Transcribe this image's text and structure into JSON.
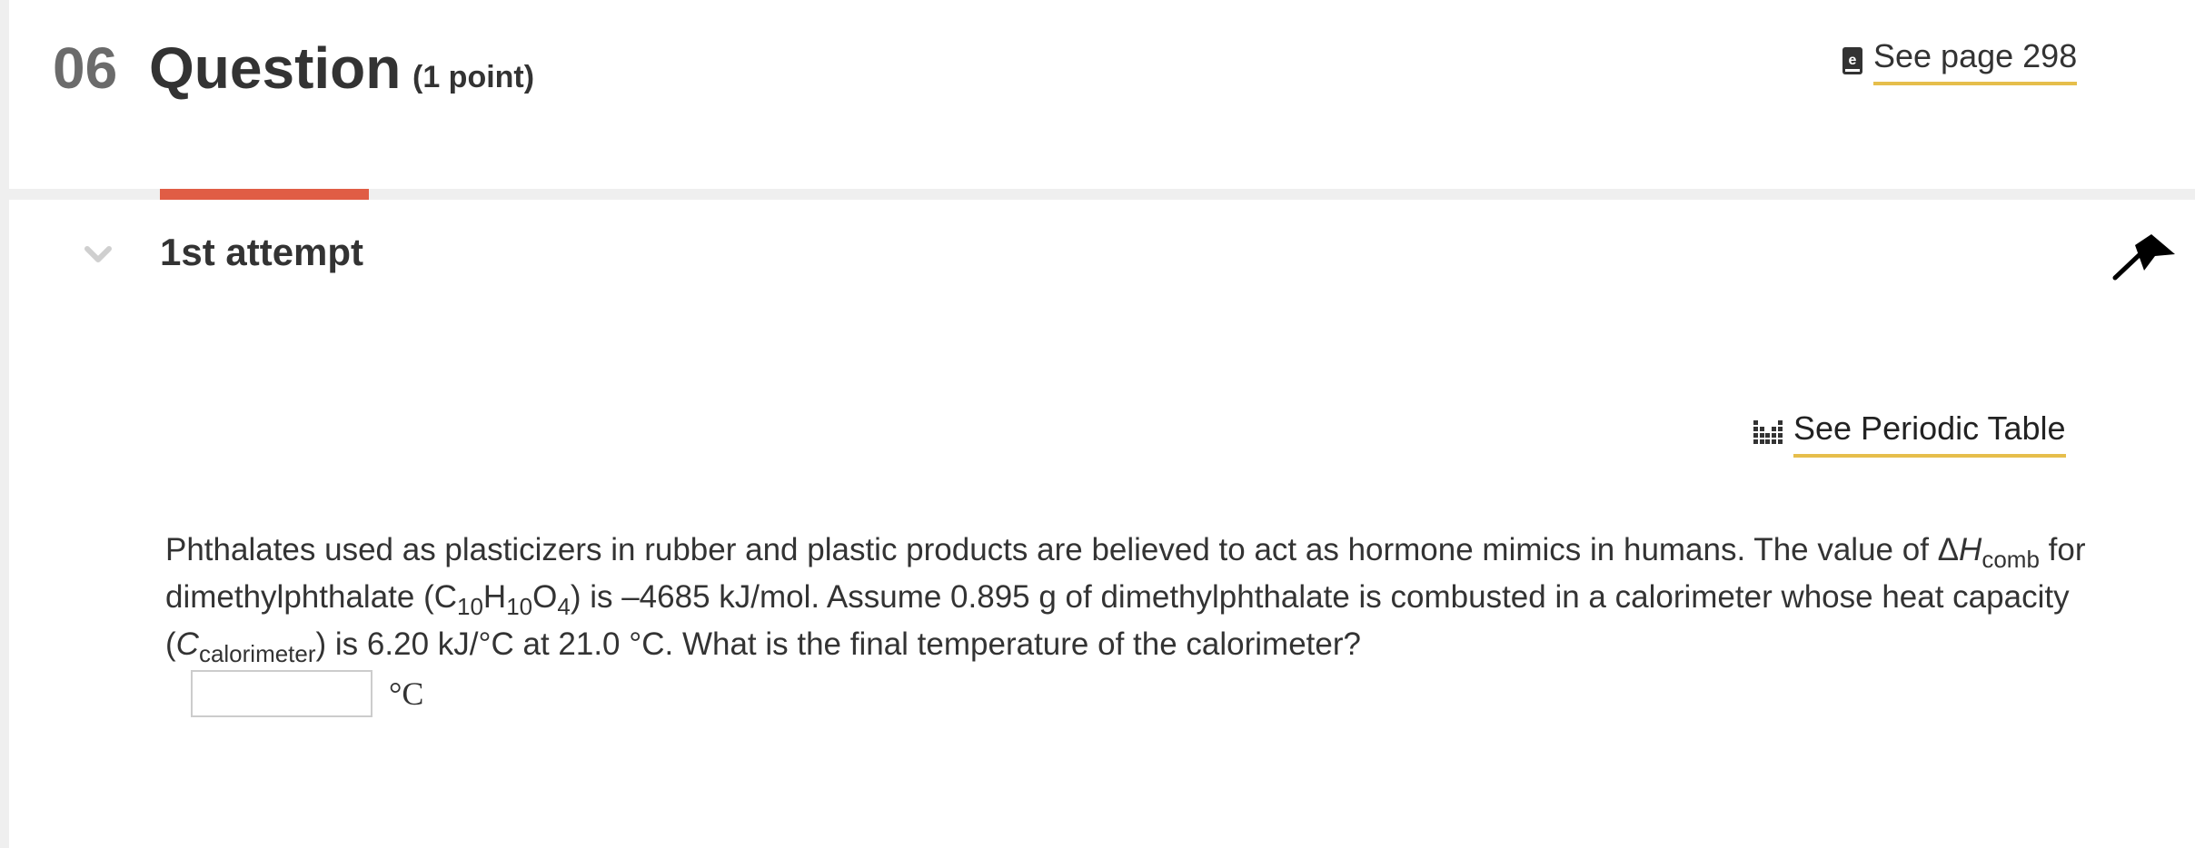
{
  "header": {
    "number": "06",
    "title": "Question",
    "points": "(1 point)",
    "reference_link": "See page 298"
  },
  "attempt": {
    "title": "1st attempt",
    "accent_color": "#e05d45"
  },
  "tools": {
    "periodic_table_link": "See Periodic Table"
  },
  "question": {
    "part1": "Phthalates used as plasticizers in rubber and plastic products are believed to act as hormone mimics in humans. The value of ",
    "delta": "Δ",
    "h_symbol": "H",
    "comb_sub": "comb",
    "part2": " for dimethylphthalate (C",
    "sub_c": "10",
    "h_elem": "H",
    "sub_h": "10",
    "o_elem": "O",
    "sub_o": "4",
    "part3": ") is –4685 kJ/mol. Assume 0.895  g of dimethylphthalate is combusted in a calorimeter whose heat capacity (",
    "c_symbol": "C",
    "calorimeter_sub": "calorimeter",
    "part4": ") is 6.20  kJ/°C at 21.0 °C. What is the final temperature of the calorimeter?"
  },
  "answer": {
    "value": "",
    "unit": "°C"
  },
  "colors": {
    "link_underline": "#e6be4b",
    "text": "#333333",
    "question_number": "#6b6b6b"
  },
  "icons": {
    "reference": "ebook-icon",
    "periodic": "periodic-table-icon",
    "collapse": "chevron-down-icon",
    "flag": "flag-icon"
  }
}
